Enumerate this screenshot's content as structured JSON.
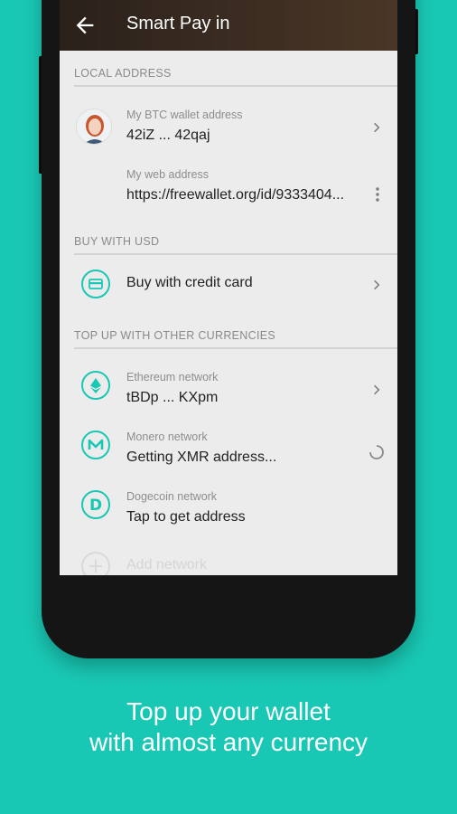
{
  "toolbar": {
    "title": "Smart Pay in"
  },
  "sections": {
    "local": "LOCAL ADDRESS",
    "buy": "BUY WITH USD",
    "topup": "TOP UP WITH OTHER CURRENCIES"
  },
  "btc": {
    "label": "My BTC wallet address",
    "value": "42iZ ... 42qaj"
  },
  "web": {
    "label": "My web address",
    "value": "https://freewallet.org/id/9333404..."
  },
  "credit": {
    "label": "Buy with credit card"
  },
  "eth": {
    "label": "Ethereum network",
    "value": "tBDp ... KXpm"
  },
  "xmr": {
    "label": "Monero network",
    "value": "Getting XMR address..."
  },
  "doge": {
    "label": "Dogecoin network",
    "value": "Tap to get address"
  },
  "add": {
    "label": "Add network"
  },
  "tagline": {
    "line1": "Top up your wallet",
    "line2": "with almost any currency"
  },
  "colors": {
    "accent": "#19c8b4",
    "toolbar": "#3a2b20"
  }
}
